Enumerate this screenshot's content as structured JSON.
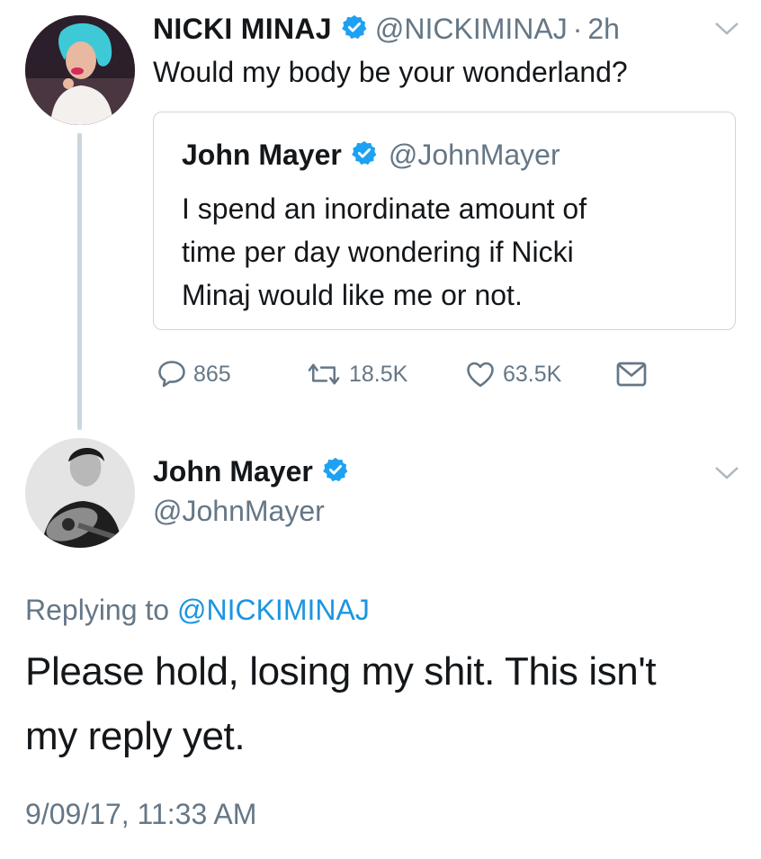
{
  "tweet": {
    "author_name": "NICKI MINAJ",
    "author_handle": "@NICKIMINAJ",
    "time_sep": "·",
    "time": "2h",
    "text": "Would my body be your wonderland?",
    "quoted": {
      "author_name": "John Mayer",
      "author_handle": "@JohnMayer",
      "text_line1": "I spend an inordinate amount of",
      "text_line2": "time per day wondering if Nicki",
      "text_line3": "Minaj would like me or not."
    },
    "actions": {
      "replies": "865",
      "retweets": "18.5K",
      "likes": "63.5K"
    }
  },
  "reply": {
    "author_name": "John Mayer",
    "author_handle": "@JohnMayer",
    "replying_prefix": "Replying to",
    "replying_handle": "@NICKIMINAJ",
    "text_line1": "Please hold, losing my shit. This isn't",
    "text_line2": "my reply yet.",
    "timestamp": "9/09/17, 11:33 AM"
  },
  "colors": {
    "verified": "#1da1f2",
    "link": "#1b95e0",
    "muted": "#657786",
    "border": "#ccd6dd"
  },
  "icons": [
    "verified-badge-icon",
    "chevron-down-icon",
    "reply-icon",
    "retweet-icon",
    "like-icon",
    "direct-message-icon"
  ]
}
